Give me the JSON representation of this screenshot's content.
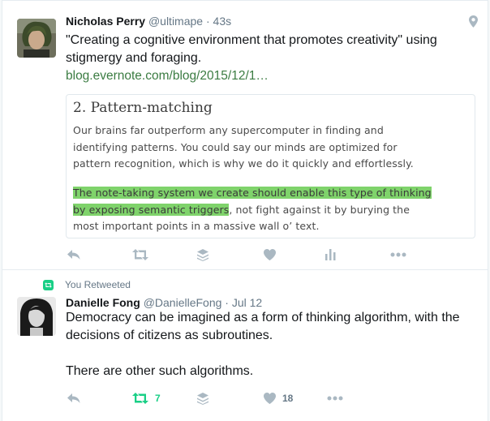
{
  "tweets": [
    {
      "author": {
        "fullname": "Nicholas Perry",
        "handle": "@ultimape"
      },
      "separator": "·",
      "time": "43s",
      "geo_icon": "map-pin-icon",
      "text_line1": "\"Creating a cognitive environment that promotes creativity\" using",
      "text_line2": "stigmergy and foraging.",
      "link": "blog.evernote.com/blog/2015/12/1…",
      "card": {
        "title": "2. Pattern-matching",
        "para1_lines": [
          "Our brains far outperform any supercomputer in finding and",
          "identifying patterns. You could say our minds are optimized for",
          "pattern recognition, which is why we do it quickly and effortlessly."
        ],
        "para2_highlight_1": "The note-taking system we create should enable this type of thinking",
        "para2_highlight_2": "by exposing semantic triggers",
        "para2_rest_2": ", not fight against it by burying the",
        "para2_line3": "most important points in a massive wall o’ text.",
        "highlight_color": "#7fd36b"
      },
      "actions": {
        "reply_icon": "reply-icon",
        "retweet_icon": "retweet-icon",
        "retweet_count": "",
        "stack_icon": "stack-icon",
        "like_icon": "heart-icon",
        "like_count": "",
        "analytics_icon": "analytics-icon",
        "more_icon": "more-icon"
      }
    },
    {
      "context": {
        "icon": "retweet-icon",
        "label": "You Retweeted"
      },
      "author": {
        "fullname": "Danielle Fong",
        "handle": "@DanielleFong"
      },
      "separator": "·",
      "time": "Jul 12",
      "text_line1": "Democracy can be imagined as a form of thinking algorithm, with the",
      "text_line2": "decisions of citizens as subroutines.",
      "text_line3": "There are other such algorithms.",
      "actions": {
        "reply_icon": "reply-icon",
        "retweet_icon": "retweet-icon",
        "retweet_count": "7",
        "stack_icon": "stack-icon",
        "like_icon": "heart-icon",
        "like_count": "18",
        "more_icon": "more-icon"
      }
    }
  ],
  "colors": {
    "retweet_active": "#19cf86",
    "link": "#1b95e0",
    "muted": "#657786",
    "icon_gray": "#aab8c2"
  }
}
